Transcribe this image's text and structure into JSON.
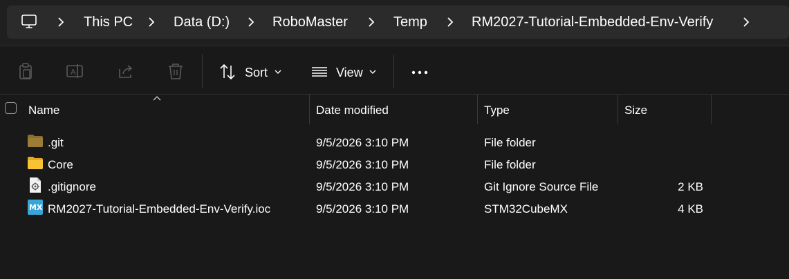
{
  "breadcrumb": {
    "root_icon": "computer-icon",
    "items": [
      "This PC",
      "Data (D:)",
      "RoboMaster",
      "Temp",
      "RM2027-Tutorial-Embedded-Env-Verify"
    ]
  },
  "toolbar": {
    "sort_label": "Sort",
    "view_label": "View",
    "icons": [
      "clipboard-icon",
      "rename-icon",
      "share-icon",
      "trash-icon",
      "sort-icon",
      "view-icon",
      "more-icon"
    ]
  },
  "columns": {
    "name": "Name",
    "date_modified": "Date modified",
    "type": "Type",
    "size": "Size"
  },
  "files": [
    {
      "name": ".git",
      "date": "9/5/2026 3:10 PM",
      "type": "File folder",
      "size": "",
      "icon": "folder-dim-icon"
    },
    {
      "name": "Core",
      "date": "9/5/2026 3:10 PM",
      "type": "File folder",
      "size": "",
      "icon": "folder-icon"
    },
    {
      "name": ".gitignore",
      "date": "9/5/2026 3:10 PM",
      "type": "Git Ignore Source File",
      "size": "2 KB",
      "icon": "settings-file-icon"
    },
    {
      "name": "RM2027-Tutorial-Embedded-Env-Verify.ioc",
      "date": "9/5/2026 3:10 PM",
      "type": "STM32CubeMX",
      "size": "4 KB",
      "icon": "stm32cubemx-icon"
    }
  ],
  "ioc_icon_text": "MX",
  "colors": {
    "background": "#191919",
    "address_box": "#2b2b2b",
    "folder": "#f8c435",
    "folder_dim": "#8a6f31",
    "mx_blue": "#39a6d9"
  }
}
